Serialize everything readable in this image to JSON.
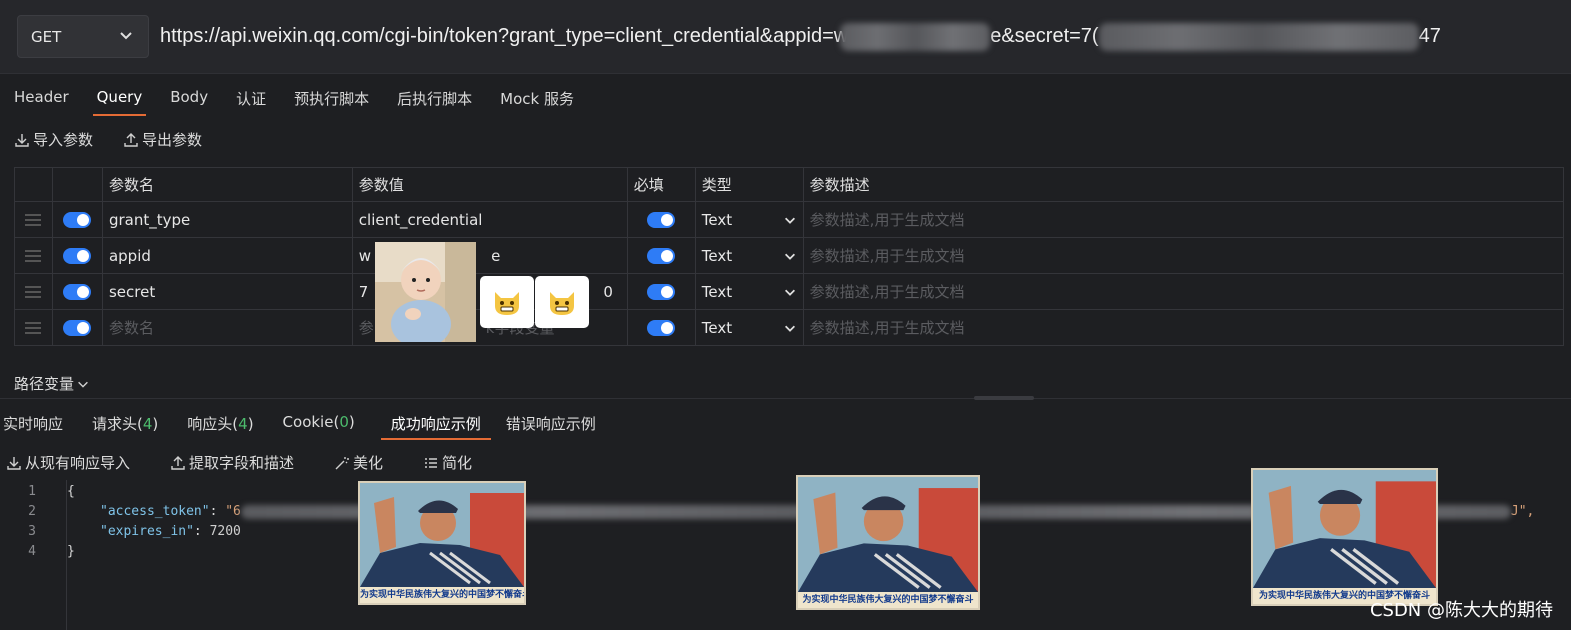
{
  "request": {
    "method": "GET",
    "url_prefix": "https://api.weixin.qq.com/cgi-bin/token?grant_type=client_credential&appid=w",
    "url_mid": "e&secret=7(",
    "url_end": "47"
  },
  "request_tabs": [
    {
      "label": "Header"
    },
    {
      "label": "Query",
      "active": true
    },
    {
      "label": "Body"
    },
    {
      "label": "认证"
    },
    {
      "label": "预执行脚本"
    },
    {
      "label": "后执行脚本"
    },
    {
      "label": "Mock 服务"
    }
  ],
  "param_tools": {
    "import": "导入参数",
    "export": "导出参数"
  },
  "param_table": {
    "headers": {
      "name": "参数名",
      "value": "参数值",
      "required": "必填",
      "type": "类型",
      "desc": "参数描述"
    },
    "rows": [
      {
        "name": "grant_type",
        "value": "client_credential",
        "type": "Text",
        "desc_placeholder": "参数描述,用于生成文档"
      },
      {
        "name": "appid",
        "value_start": "w",
        "value_end": "e",
        "type": "Text",
        "desc_placeholder": "参数描述,用于生成文档"
      },
      {
        "name": "secret",
        "value_start": "7",
        "value_end": "0",
        "type": "Text",
        "desc_placeholder": "参数描述,用于生成文档"
      }
    ],
    "new_row": {
      "name_placeholder": "参数名",
      "value_placeholder_start": "参",
      "value_placeholder_end": "k字段变量",
      "type": "Text",
      "desc_placeholder": "参数描述,用于生成文档"
    }
  },
  "path_variables": {
    "label": "路径变量"
  },
  "response_tabs": [
    {
      "label": "实时响应"
    },
    {
      "label": "请求头(",
      "count": "4",
      "suffix": ")"
    },
    {
      "label": "响应头(",
      "count": "4",
      "suffix": ")"
    },
    {
      "label": "Cookie(",
      "count": "0",
      "suffix": ")"
    },
    {
      "label": "成功响应示例",
      "active": true
    },
    {
      "label": "错误响应示例"
    }
  ],
  "response_tools": {
    "import": "从现有响应导入",
    "extract": "提取字段和描述",
    "beautify": "美化",
    "simplify": "简化"
  },
  "code": {
    "line_numbers": [
      "1",
      "2",
      "3",
      "4"
    ],
    "open_brace": "{",
    "key1": "\"access_token\"",
    "val1_start": "\"6",
    "val1_end": "J\",",
    "key2": "\"expires_in\"",
    "val2": "7200",
    "close_brace": "}"
  },
  "poster_caption": "为实现中华民族伟大复兴的中国梦不懈奋斗",
  "watermark": "CSDN @陈大大的期待",
  "colors": {
    "accent": "#e46b35",
    "toggle": "#2e7cf6",
    "count": "#4cbb6c"
  }
}
